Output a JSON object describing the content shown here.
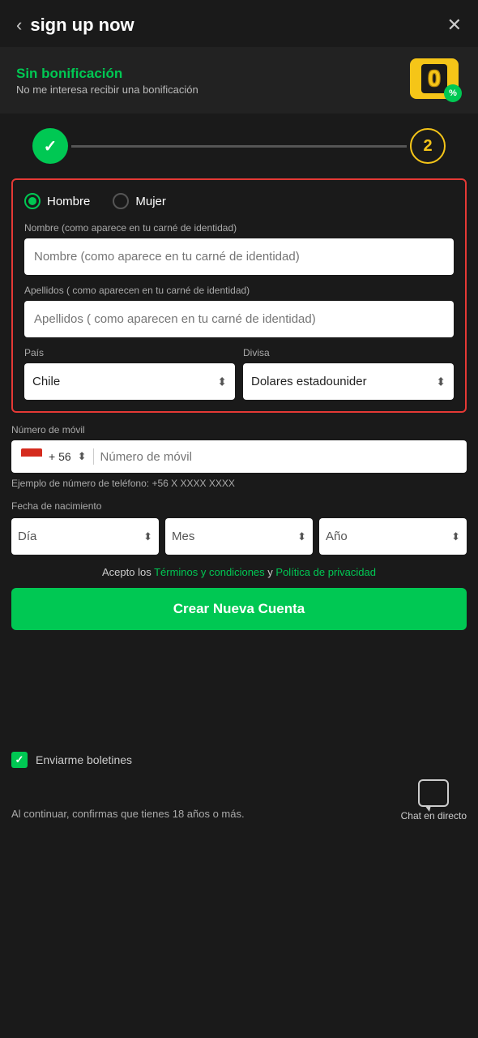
{
  "header": {
    "title": "sign up now",
    "back_label": "‹",
    "close_label": "✕"
  },
  "bonus": {
    "title": "Sin bonificación",
    "subtitle": "No me interesa recibir una bonificación",
    "badge_number": "0",
    "badge_percent": "%"
  },
  "stepper": {
    "step1_done": "✓",
    "step2_label": "2"
  },
  "form": {
    "gender": {
      "male_label": "Hombre",
      "female_label": "Mujer"
    },
    "name_label": "Nombre (como aparece en tu carné de identidad)",
    "name_placeholder": "Nombre (como aparece en tu carné de identidad)",
    "lastname_label": "Apellidos ( como aparecen en tu carné de identidad)",
    "lastname_placeholder": "Apellidos ( como aparecen en tu carné de identidad)",
    "country_label": "País",
    "country_value": "Chile",
    "currency_label": "Divisa",
    "currency_value": "Dolares estadounider"
  },
  "phone": {
    "section_label": "Número de móvil",
    "code": "+ 56",
    "placeholder": "Número de móvil",
    "hint": "Ejemplo de número de teléfono: +56 X XXXX XXXX"
  },
  "birthdate": {
    "section_label": "Fecha de nacimiento",
    "day_placeholder": "Día",
    "month_placeholder": "Mes",
    "year_placeholder": "Año"
  },
  "terms": {
    "prefix": "Acepto los ",
    "terms_link": "Términos y condiciones",
    "conjunction": " y ",
    "privacy_link": "Política de privacidad"
  },
  "create_button": "Crear Nueva Cuenta",
  "newsletter": {
    "label": "Enviarme boletines"
  },
  "footer": {
    "text": "Al continuar, confirmas que tienes 18 años o más.",
    "chat_label": "Chat en directo"
  }
}
